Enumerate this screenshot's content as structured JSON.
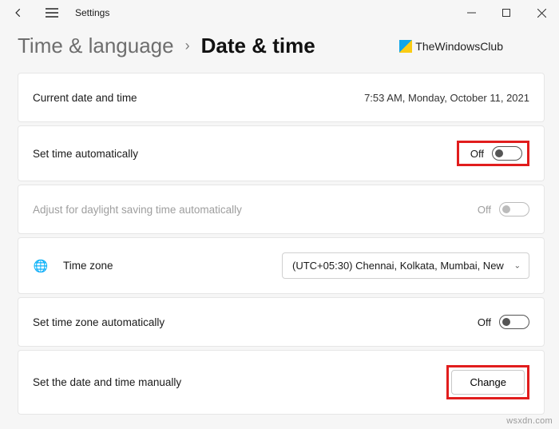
{
  "app": {
    "title": "Settings"
  },
  "breadcrumb": {
    "parent": "Time & language",
    "separator": "›",
    "current": "Date & time"
  },
  "logo": {
    "text": "TheWindowsClub"
  },
  "rows": {
    "current": {
      "label": "Current date and time",
      "value": "7:53 AM, Monday, October 11, 2021"
    },
    "autoTime": {
      "label": "Set time automatically",
      "state": "Off"
    },
    "dst": {
      "label": "Adjust for daylight saving time automatically",
      "state": "Off"
    },
    "timezone": {
      "label": "Time zone",
      "selected": "(UTC+05:30) Chennai, Kolkata, Mumbai, New"
    },
    "autoTz": {
      "label": "Set time zone automatically",
      "state": "Off"
    },
    "manual": {
      "label": "Set the date and time manually",
      "button": "Change"
    }
  },
  "watermark": "wsxdn.com"
}
